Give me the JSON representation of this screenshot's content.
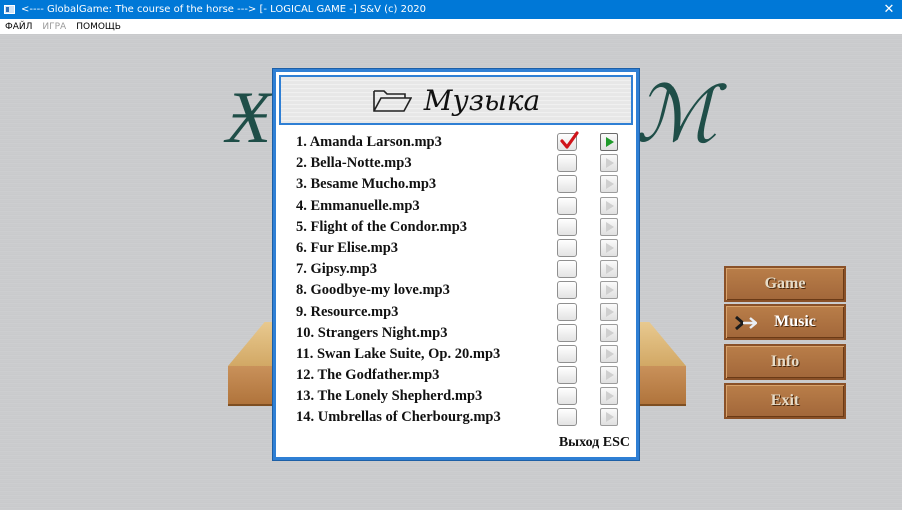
{
  "window": {
    "title": "<---- GlobalGame:  The course of the horse ---> [- LOGICAL GAME -]  S&V (c) 2020"
  },
  "menu": [
    {
      "label": "ФАЙЛ",
      "enabled": true
    },
    {
      "label": "ИГРА",
      "enabled": false
    },
    {
      "label": "ПОМОЩЬ",
      "enabled": true
    }
  ],
  "dialog": {
    "title": "Музыка",
    "exit_hint": "Выход ESC",
    "tracks": [
      {
        "label": "1.   Amanda Larson.mp3",
        "checked": true,
        "playing": true
      },
      {
        "label": "2.   Bella-Notte.mp3",
        "checked": false,
        "playing": false
      },
      {
        "label": "3.   Besame Mucho.mp3",
        "checked": false,
        "playing": false
      },
      {
        "label": "4.   Emmanuelle.mp3",
        "checked": false,
        "playing": false
      },
      {
        "label": "5.   Flight of the Condor.mp3",
        "checked": false,
        "playing": false
      },
      {
        "label": "6.   Fur Elise.mp3",
        "checked": false,
        "playing": false
      },
      {
        "label": "7.   Gipsy.mp3",
        "checked": false,
        "playing": false
      },
      {
        "label": "8.   Goodbye-my love.mp3",
        "checked": false,
        "playing": false
      },
      {
        "label": "9.   Resource.mp3",
        "checked": false,
        "playing": false
      },
      {
        "label": "10.   Strangers Night.mp3",
        "checked": false,
        "playing": false
      },
      {
        "label": "11.   Swan Lake Suite, Op. 20.mp3",
        "checked": false,
        "playing": false
      },
      {
        "label": "12.   The Godfather.mp3",
        "checked": false,
        "playing": false
      },
      {
        "label": "13.   The Lonely Shepherd.mp3",
        "checked": false,
        "playing": false
      },
      {
        "label": "14.   Umbrellas of Cherbourg.mp3",
        "checked": false,
        "playing": false
      }
    ]
  },
  "side_buttons": {
    "game": "Game",
    "music": "Music",
    "info": "Info",
    "exit": "Exit"
  },
  "colors": {
    "titlebar": "#0078d7",
    "dialog_border": "#2f7fd4",
    "button_wood": "#a86d3e",
    "check_mark": "#d0141a",
    "play_active": "#1f9a2a"
  }
}
